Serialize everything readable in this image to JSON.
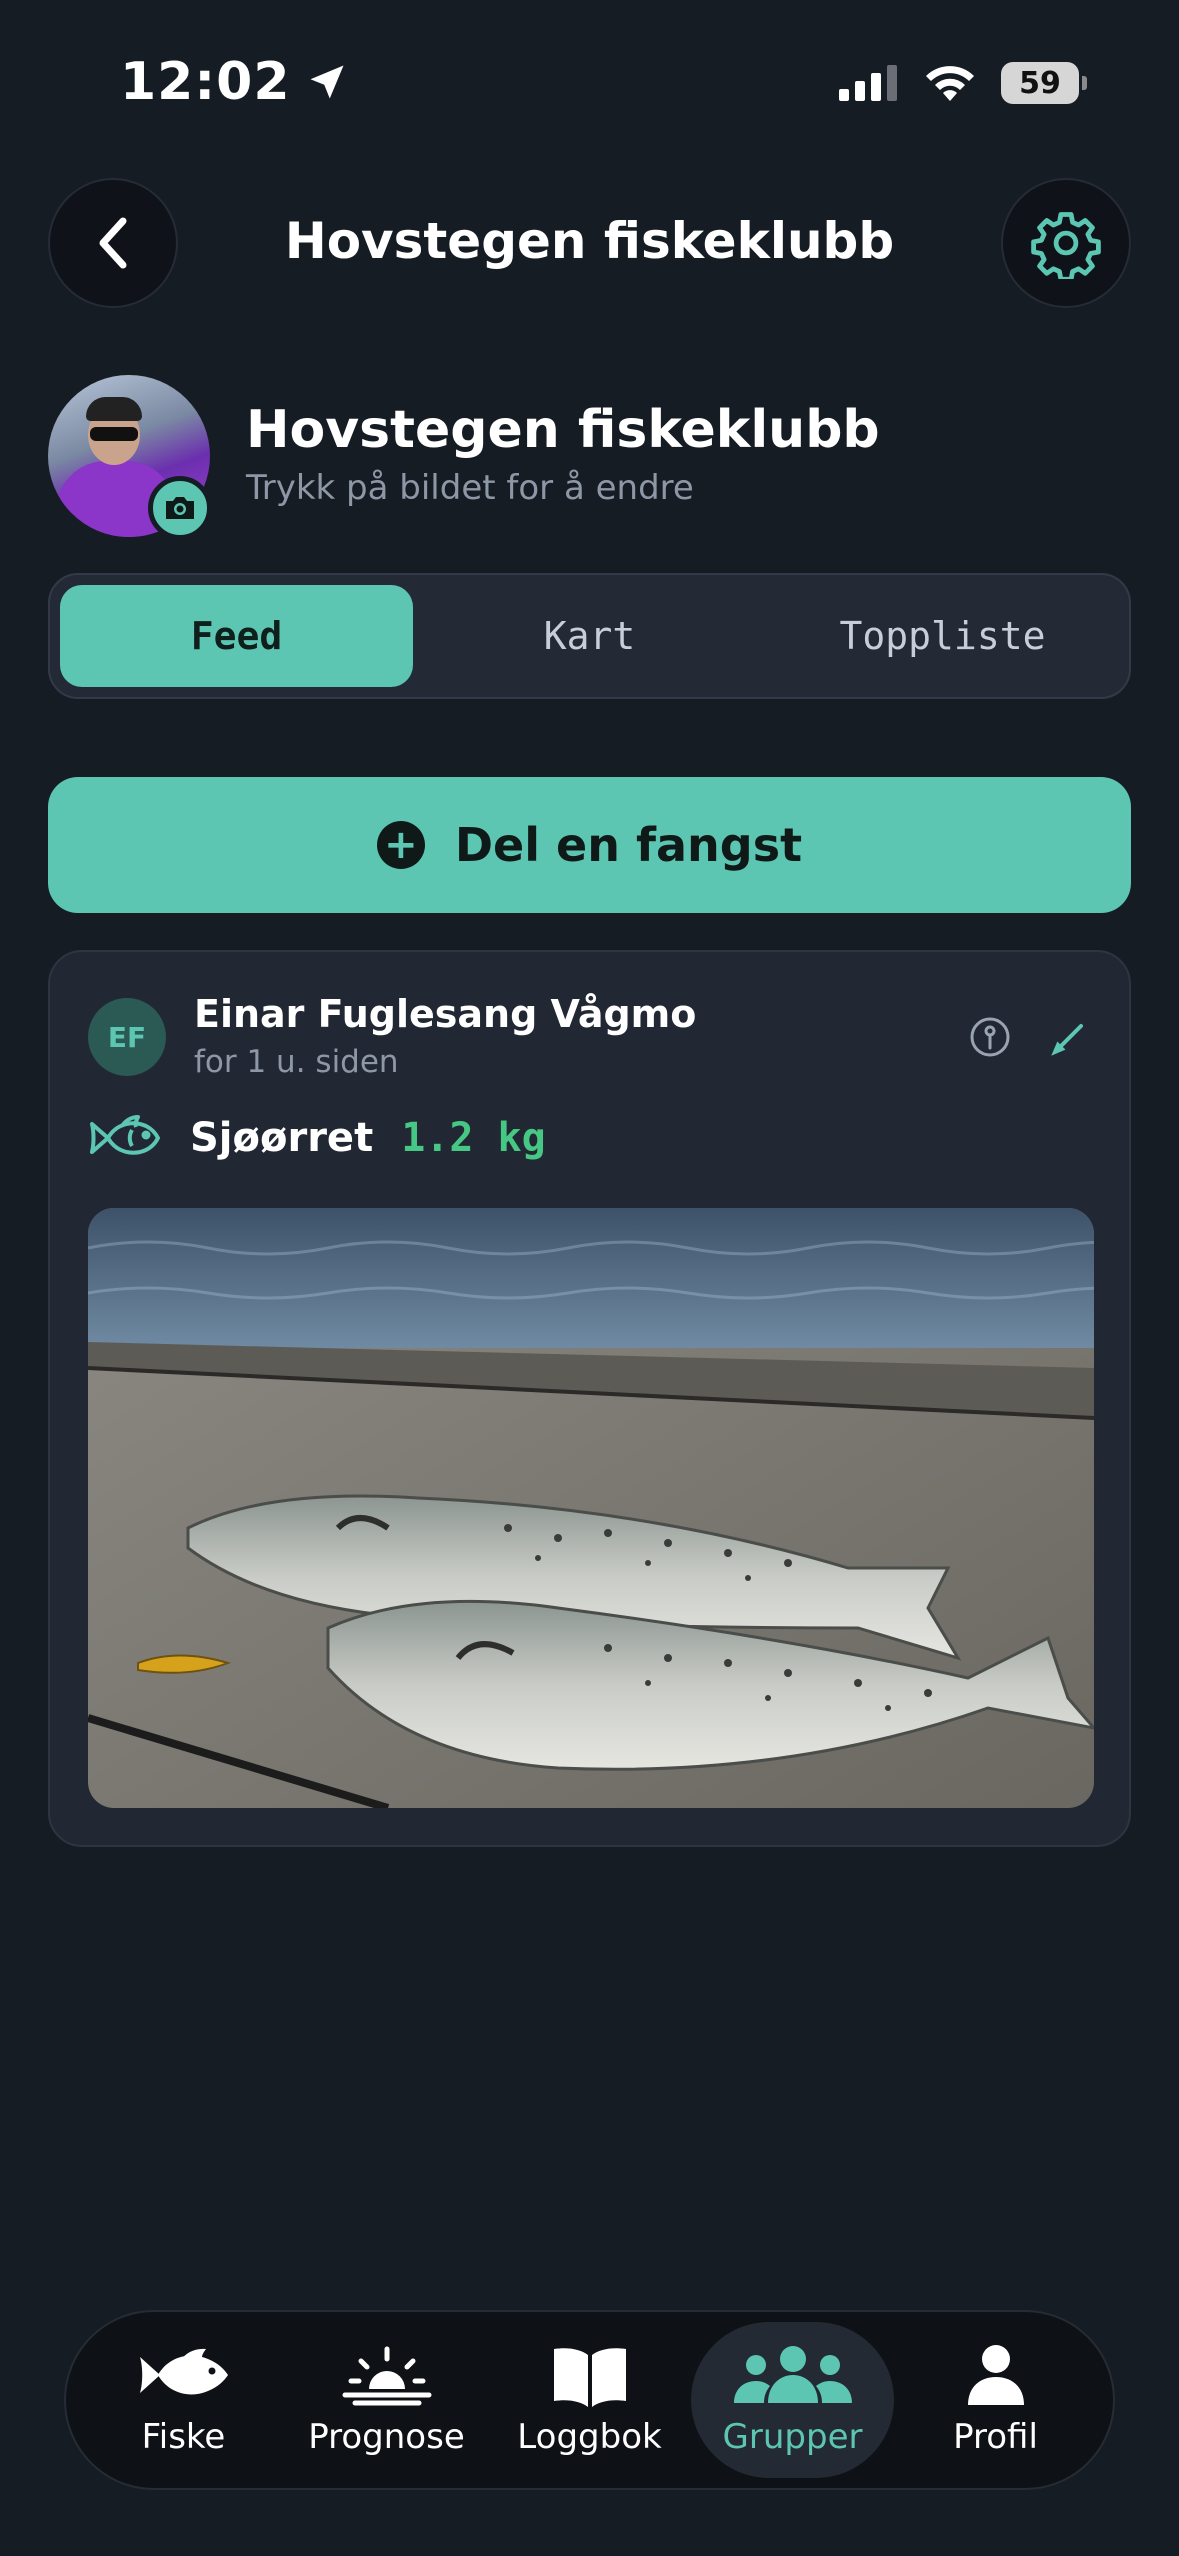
{
  "status_bar": {
    "time": "12:02",
    "battery": "59"
  },
  "header": {
    "title": "Hovstegen fiskeklubb"
  },
  "group": {
    "name": "Hovstegen fiskeklubb",
    "hint": "Trykk på bildet for å endre"
  },
  "tabs": [
    {
      "label": "Feed",
      "active": true
    },
    {
      "label": "Kart",
      "active": false
    },
    {
      "label": "Toppliste",
      "active": false
    }
  ],
  "share_button": {
    "label": "Del en fangst"
  },
  "post": {
    "initials": "EF",
    "user": "Einar Fuglesang Vågmo",
    "time": "for 1 u. siden",
    "species": "Sjøørret",
    "weight": "1.2 kg"
  },
  "nav": [
    {
      "label": "Fiske",
      "icon": "fish-icon"
    },
    {
      "label": "Prognose",
      "icon": "sunrise-icon"
    },
    {
      "label": "Loggbok",
      "icon": "book-icon"
    },
    {
      "label": "Grupper",
      "icon": "group-icon",
      "active": true
    },
    {
      "label": "Profil",
      "icon": "person-icon"
    }
  ],
  "colors": {
    "accent": "#5cc6b3",
    "background": "#161c24",
    "card": "#212833",
    "weight": "#46c784"
  }
}
